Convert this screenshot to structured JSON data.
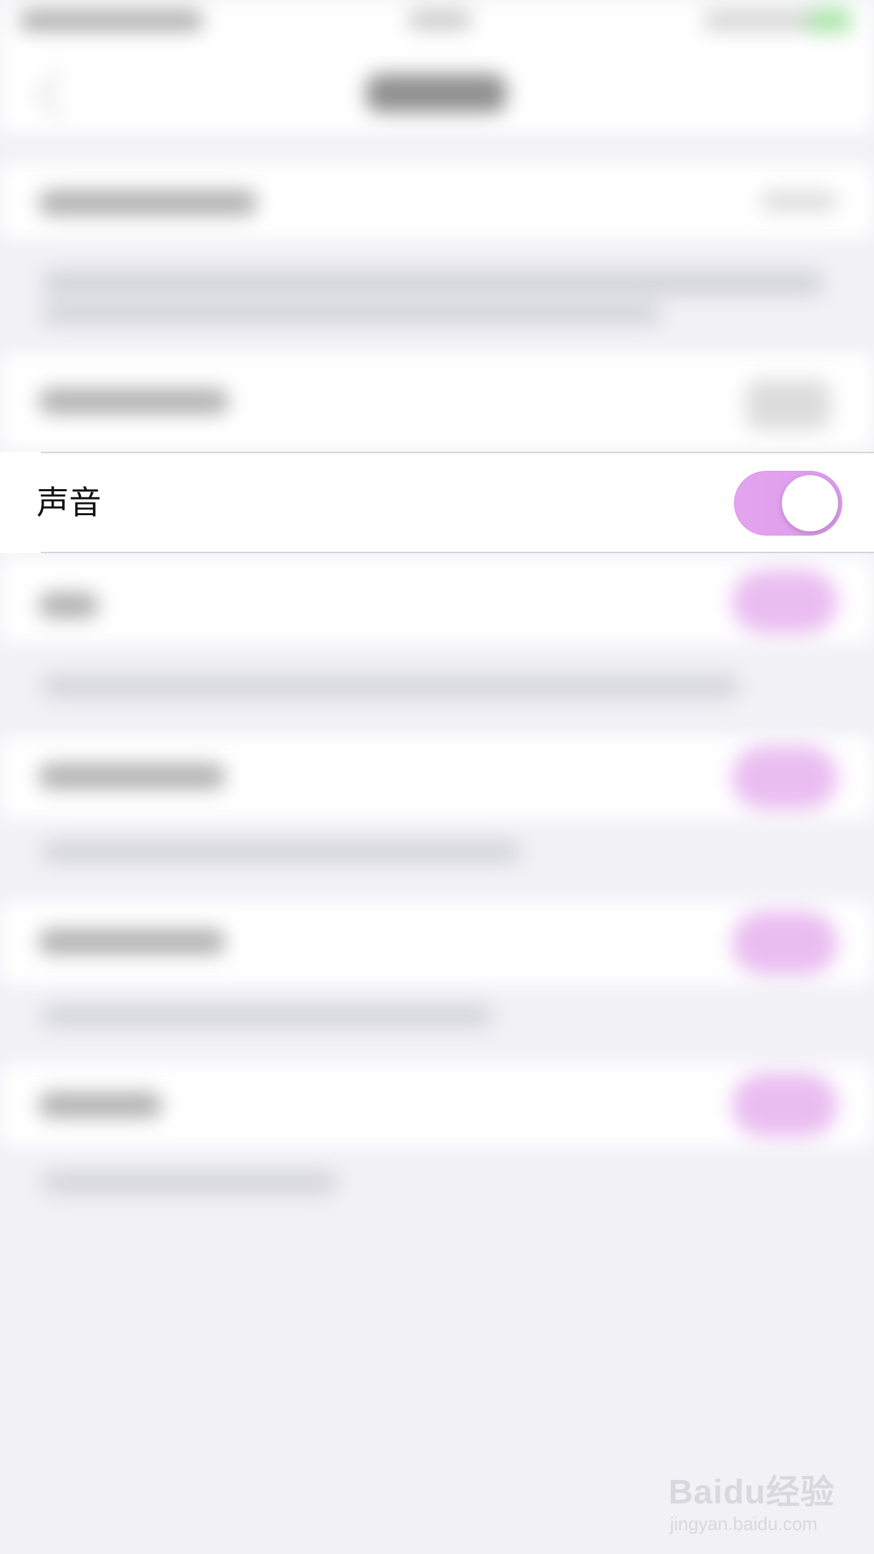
{
  "settings": {
    "sound_label": "声音",
    "sound_toggle_on": true
  },
  "colors": {
    "toggle_on": "#e3a5ee",
    "background": "#f1f1f6",
    "row": "#ffffff",
    "divider": "#d6d6da"
  },
  "icons": {
    "back": "chevron-left-icon",
    "watermark": "baidu-paw-icon"
  },
  "watermark": {
    "main": "Baidu经验",
    "sub": "jingyan.baidu.com"
  }
}
